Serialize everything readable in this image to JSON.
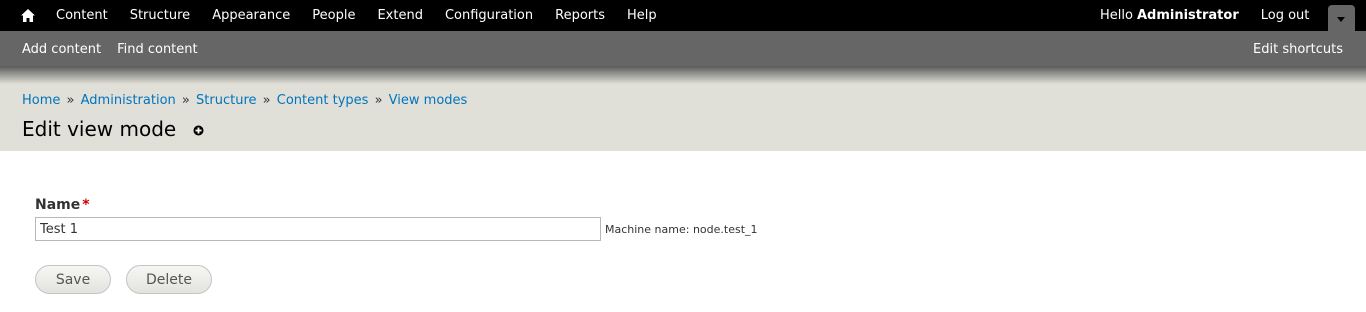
{
  "toolbar": {
    "home_icon": "home-icon",
    "menu": [
      "Content",
      "Structure",
      "Appearance",
      "People",
      "Extend",
      "Configuration",
      "Reports",
      "Help"
    ],
    "hello": "Hello",
    "username": "Administrator",
    "logout": "Log out",
    "drawer_icon": "chevron-down-icon"
  },
  "shortcuts": {
    "links": [
      "Add content",
      "Find content"
    ],
    "edit": "Edit shortcuts"
  },
  "breadcrumb": {
    "items": [
      "Home",
      "Administration",
      "Structure",
      "Content types",
      "View modes"
    ],
    "separator": "»"
  },
  "page": {
    "title": "Edit view mode",
    "add_shortcut_icon": "plus-circle-icon"
  },
  "form": {
    "name_label": "Name",
    "required_marker": "*",
    "name_value": "Test 1",
    "machine_name": "Machine name: node.test_1",
    "save_label": "Save",
    "delete_label": "Delete"
  },
  "colors": {
    "toolbar_bg": "#000000",
    "shortcuts_bg": "#666666",
    "header_bg": "#e0e0d8",
    "link": "#0074bd",
    "required": "#cc0000"
  }
}
